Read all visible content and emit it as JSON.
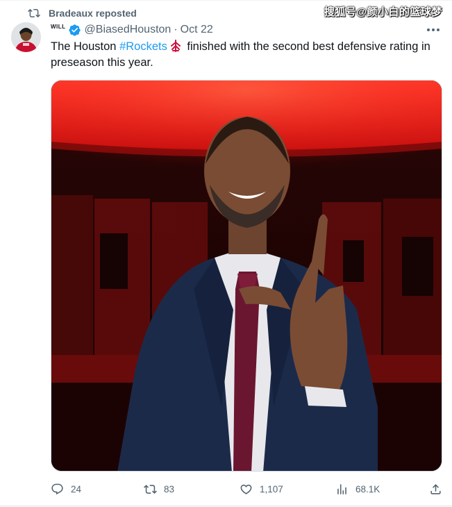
{
  "repost": {
    "label": "Bradeaux reposted",
    "icon": "repost-icon"
  },
  "watermark": "搜狐号@颜小白的篮球梦",
  "author": {
    "display_name": "WILL",
    "handle": "@BiasedHouston",
    "timestamp": "Oct 22",
    "verified": true
  },
  "tweet": {
    "text_before": "The Houston ",
    "hashtag": "#Rockets",
    "text_after": " finished with the second best defensive rating in preseason this year."
  },
  "media": {
    "description_icon": "photo"
  },
  "actions": {
    "replies": "24",
    "reposts": "83",
    "likes": "1,107",
    "views": "68.1K"
  },
  "colors": {
    "accent": "#1d9bf0",
    "text": "#0f1419",
    "muted": "#536471",
    "rockets_red": "#ce1141"
  }
}
